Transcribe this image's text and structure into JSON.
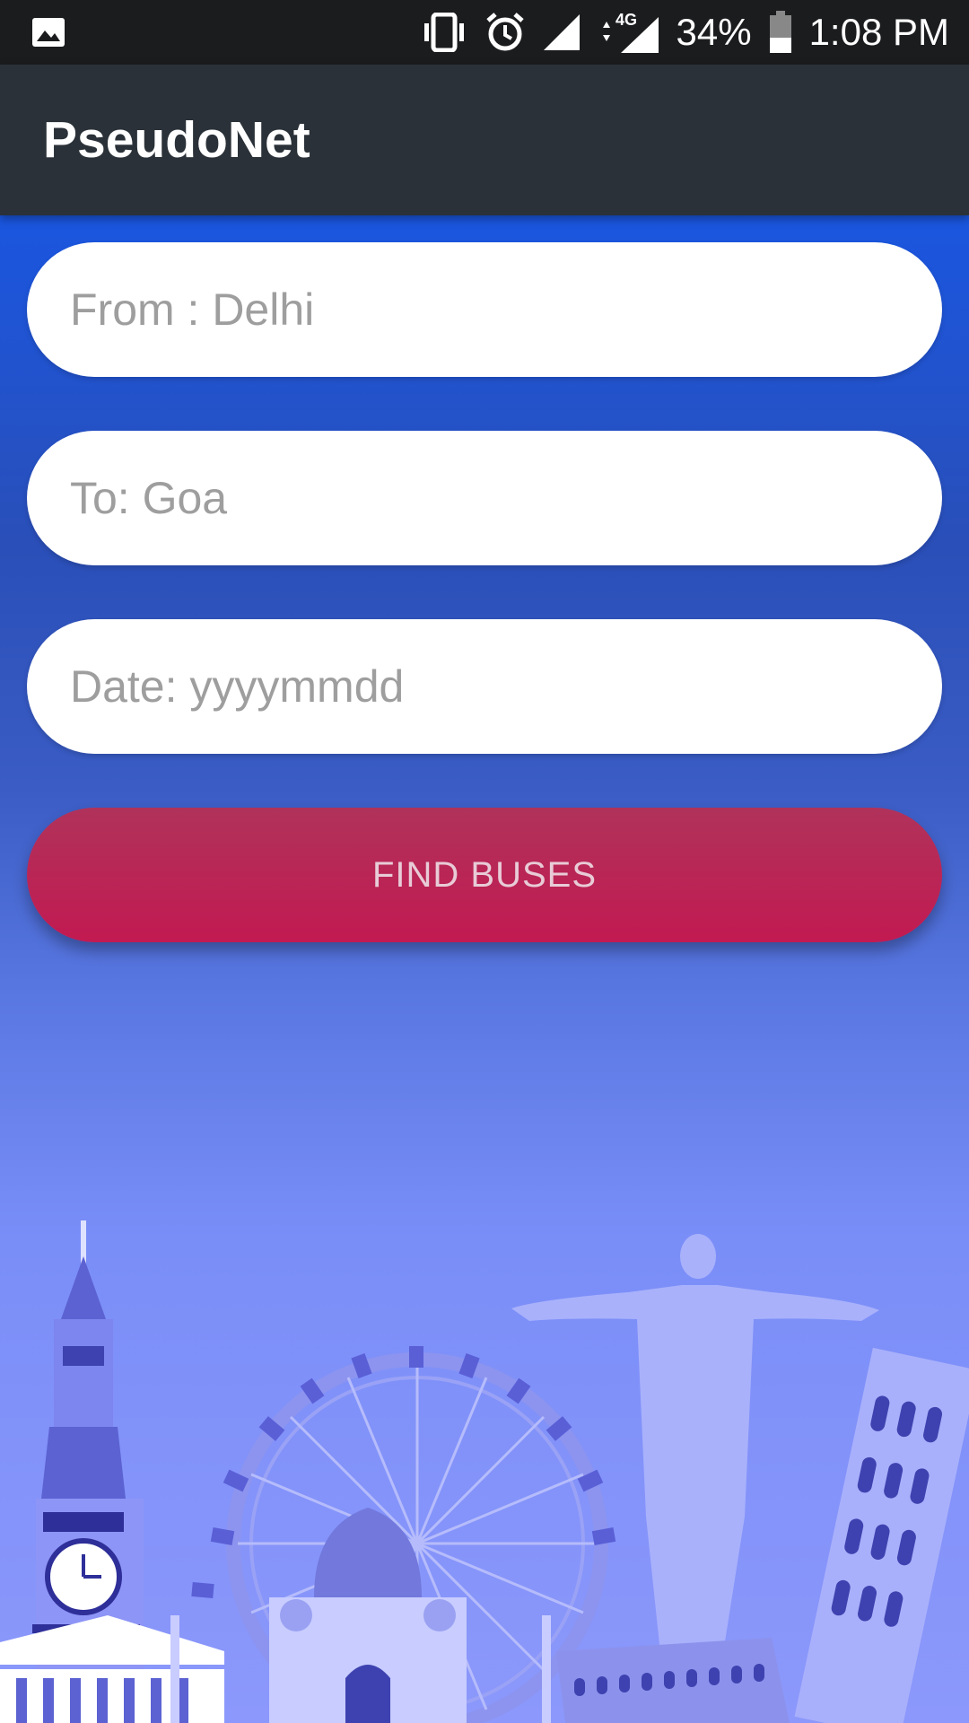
{
  "status_bar": {
    "battery": "34%",
    "time": "1:08 PM",
    "network": "4G",
    "icons": [
      "image-icon",
      "vibrate-icon",
      "alarm-icon",
      "signal-icon",
      "data-arrows-icon",
      "signal-4g-icon",
      "battery-icon"
    ]
  },
  "app_bar": {
    "title": "PseudoNet"
  },
  "form": {
    "from_placeholder": "From : Delhi",
    "to_placeholder": "To: Goa",
    "date_placeholder": "Date: yyyymmdd",
    "find_button": "FIND BUSES"
  },
  "colors": {
    "status_bar": "#1b1c1e",
    "app_bar": "#2a3138",
    "gradient_top": "#1a56e0",
    "gradient_bottom": "#8c98fb",
    "button": "#c21a52"
  }
}
